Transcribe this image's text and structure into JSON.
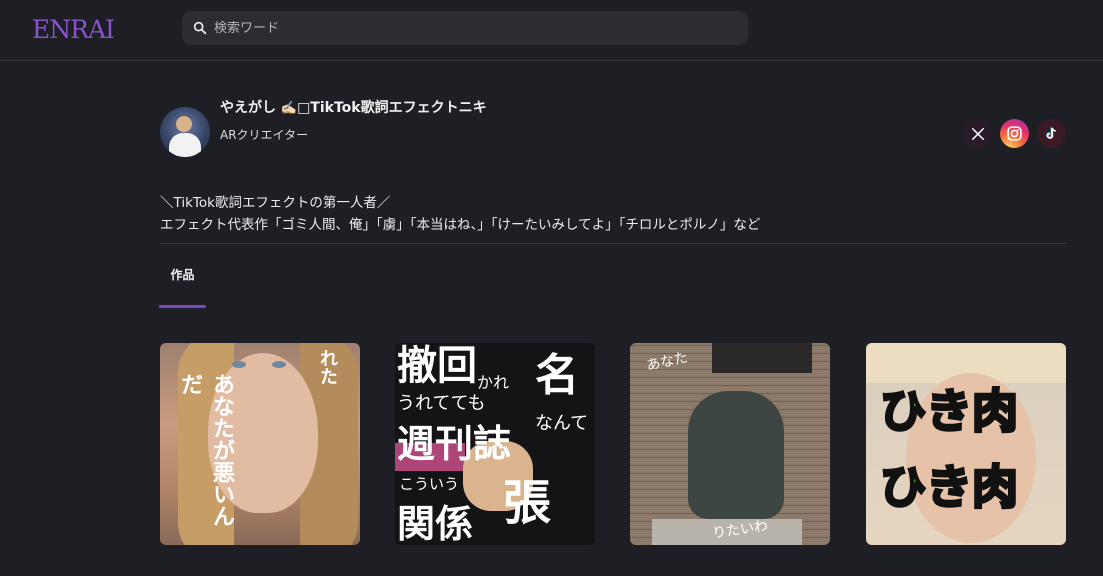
{
  "header": {
    "logo": "ENRAI",
    "search_placeholder": "検索ワード"
  },
  "profile": {
    "name": "やえがし",
    "name_emoji": "✍🏻",
    "name_suffix": "□TikTok歌詞エフェクトニキ",
    "role": "ARクリエイター",
    "socials": [
      "x-icon",
      "instagram-icon",
      "tiktok-icon"
    ]
  },
  "bio": {
    "line1": "＼TikTok歌詞エフェクトの第一人者／",
    "line2": "エフェクト代表作「ゴミ人間、俺」「虜」「本当はね、」「けーたいみしてよ」「チロルとポルノ」など"
  },
  "tabs": {
    "works": "作品"
  },
  "works": {
    "card1": {
      "t1": "れた",
      "t2": "あなたが悪いんだ"
    },
    "card2": {
      "b1": "撤回",
      "b2": "週刊誌",
      "b3": "関係",
      "b4": "張",
      "s1": "かれ",
      "s2": "うれてても",
      "s3": "なんて",
      "s4": "こういう",
      "s5": "名"
    },
    "card3": {
      "t1": "あなた",
      "t2": "りたいわ"
    },
    "card4": {
      "t1": "ひき肉",
      "t2": "ひき肉"
    }
  },
  "colors": {
    "background": "#1d1f24",
    "accent": "#7b45c4",
    "logo": "#8a52cf"
  }
}
